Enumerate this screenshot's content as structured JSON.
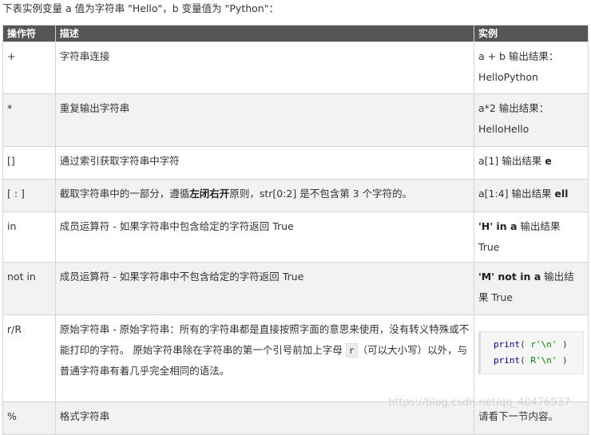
{
  "intro": "下表实例变量 a 值为字符串 \"Hello\"，b 变量值为 \"Python\"：",
  "headers": {
    "op": "操作符",
    "desc": "描述",
    "ex": "实例"
  },
  "rows": [
    {
      "op": "+",
      "desc": "字符串连接",
      "ex1": "a + b 输出结果：",
      "ex2": "HelloPython"
    },
    {
      "op": "*",
      "desc": "重复输出字符串",
      "ex1": "a*2 输出结果：",
      "ex2": "HelloHello"
    },
    {
      "op": "[]",
      "desc": "通过索引获取字符串中字符",
      "ex_pre": "a[1] 输出结果 ",
      "ex_bold": "e"
    },
    {
      "op": "[ : ]",
      "desc_pre": "截取字符串中的一部分，遵循",
      "desc_bold": "左闭右开",
      "desc_post": "原则，str[0:2] 是不包含第 3 个字符的。",
      "ex_pre": "a[1:4] 输出结果 ",
      "ex_bold": "ell"
    },
    {
      "op": "in",
      "desc": "成员运算符 - 如果字符串中包含给定的字符返回 True",
      "ex_bold": "'H' in a",
      "ex_post": " 输出结果 True"
    },
    {
      "op": "not in",
      "desc": "成员运算符 - 如果字符串中不包含给定的字符返回 True",
      "ex_bold": "'M' not in a",
      "ex_post": " 输出结果 True"
    },
    {
      "op": "r/R",
      "desc_pre": "原始字符串 - 原始字符串：所有的字符串都是直接按照字面的意思来使用，没有转义特殊或不能打印的字符。 原始字符串除在字符串的第一个引号前加上字母 ",
      "desc_code": "r",
      "desc_post": "（可以大小写）以外，与普通字符串有着几乎完全相同的语法。",
      "code_lines": [
        {
          "fn": "print",
          "open": "( ",
          "str": "r'\\n'",
          "close": " )"
        },
        {
          "fn": "print",
          "open": "( ",
          "str": "R'\\n'",
          "close": " )"
        }
      ]
    },
    {
      "op": "%",
      "desc": "格式字符串",
      "ex": "请看下一节内容。"
    }
  ],
  "watermark": "https://blog.csdn.net/qq_40476937"
}
